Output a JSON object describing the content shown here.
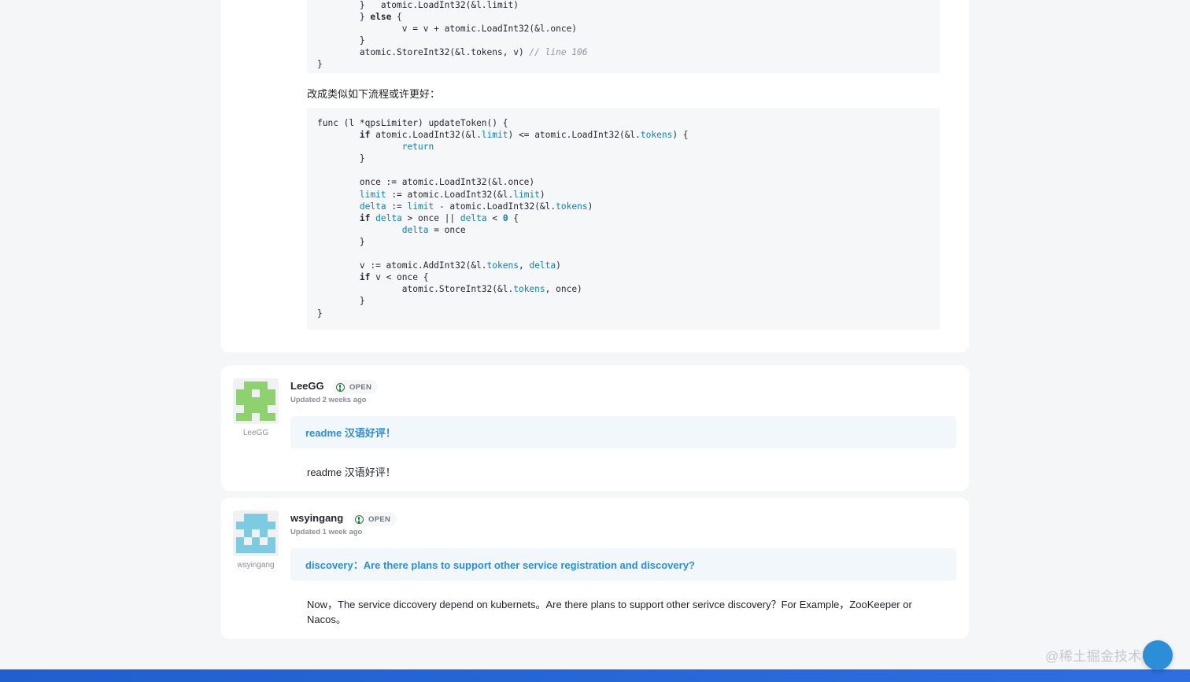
{
  "code_block_1": {
    "lines": [
      "}",
      "atomic.StoreInt32(&l.tokens, v)",
      "// line 106"
    ]
  },
  "instruction": "改成类似如下流程或许更好：",
  "issues": [
    {
      "author": "LeeGG",
      "avatar_name": "LeeGG",
      "status": "OPEN",
      "updated": "Updated 2 weeks ago",
      "title": "readme 汉语好评！",
      "body": "readme 汉语好评！",
      "avatar_color": "#8fd16e"
    },
    {
      "author": "wsyingang",
      "avatar_name": "wsyingang",
      "status": "OPEN",
      "updated": "Updated 1 week ago",
      "title": "discovery：Are there plans to support other service registration and discovery?",
      "body": "Now，The service diccovery depend on kubernets。Are there plans to support other serivce discovery？For Example，ZooKeeper or Nacos。",
      "avatar_color": "#7ccbe0"
    }
  ],
  "watermark": "@稀土掘金技术社区",
  "colors": {
    "accent": "#2b8ed6",
    "open_status": "#1a7f37",
    "footer": "#1f5fd0"
  }
}
